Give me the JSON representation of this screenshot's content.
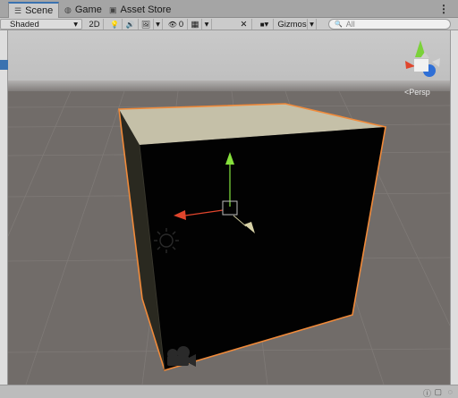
{
  "tabs": [
    {
      "label": "Scene",
      "icon": "scene-icon",
      "glyph": "☰",
      "active": true
    },
    {
      "label": "Game",
      "icon": "game-icon",
      "glyph": "◍",
      "active": false
    },
    {
      "label": "Asset Store",
      "icon": "store-icon",
      "glyph": "▣",
      "active": false
    }
  ],
  "tab_menu_glyph": "⋮",
  "toolbar": {
    "shading_mode": "Shaded",
    "dropdown_glyph": "▾",
    "mode_2d": "2D",
    "lighting_glyph": "💡",
    "audio_glyph": "🔊",
    "effects_glyph": "🖼",
    "hidden_glyph": "👁",
    "hidden_count": "0",
    "grid_glyph": "▦",
    "tools_glyph": "✕",
    "camera_glyph": "■",
    "gizmos_label": "Gizmos",
    "search_icon_glyph": "🔍",
    "search_placeholder": "All"
  },
  "view": {
    "projection_label": "Persp",
    "projection_glyph": "<"
  },
  "colors": {
    "selection_outline": "#f08a3a",
    "cube_top": "#c5c0a8",
    "cube_front": "#020202",
    "cube_left": "#22211a",
    "ground": "#716c69",
    "sky": "#c7c7c7",
    "axis_y": "#7bd23a",
    "axis_x": "#e0452c",
    "axis_z": "#2f6fd6",
    "accent": "#3a72b0"
  },
  "status": {
    "icons": [
      "info-icon",
      "notification-icon",
      "collab-icon"
    ]
  }
}
